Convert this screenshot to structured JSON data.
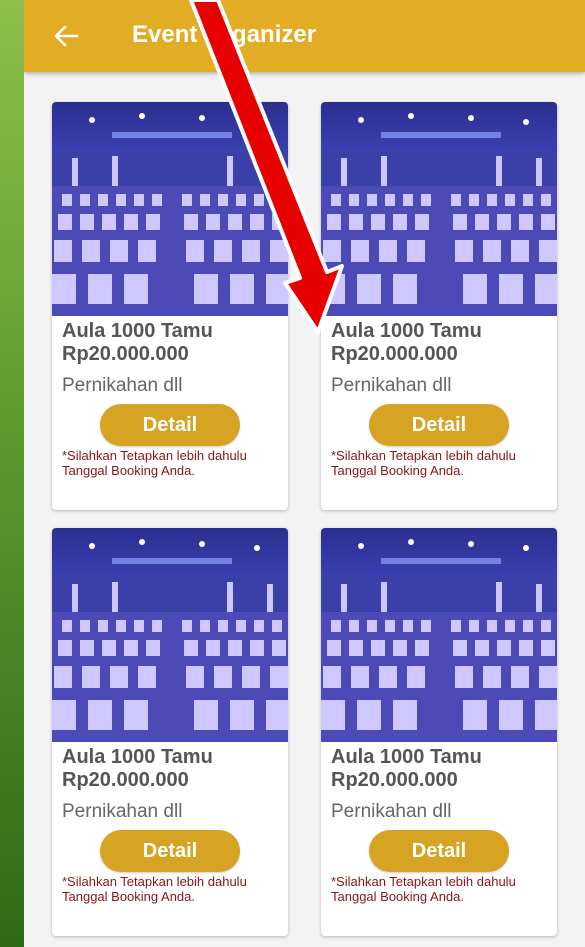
{
  "appbar": {
    "title": "Event Organizer",
    "back_icon": "arrow-left-icon",
    "color": "#e2ad25"
  },
  "cards": [
    {
      "name": "Aula 1000 Tamu",
      "price": "Rp20.000.000",
      "category": "Pernikahan dll",
      "button": "Detail",
      "note": "*Silahkan Tetapkan lebih dahulu Tanggal Booking Anda."
    },
    {
      "name": "Aula 1000 Tamu",
      "price": "Rp20.000.000",
      "category": "Pernikahan dll",
      "button": "Detail",
      "note": "*Silahkan Tetapkan lebih dahulu Tanggal Booking Anda."
    },
    {
      "name": "Aula 1000 Tamu",
      "price": "Rp20.000.000",
      "category": "Pernikahan dll",
      "button": "Detail",
      "note": "*Silahkan Tetapkan lebih dahulu Tanggal Booking Anda."
    },
    {
      "name": "Aula 1000 Tamu",
      "price": "Rp20.000.000",
      "category": "Pernikahan dll",
      "button": "Detail",
      "note": "*Silahkan Tetapkan lebih dahulu Tanggal Booking Anda."
    }
  ],
  "colors": {
    "accent": "#e2ad25",
    "button": "#d6a422",
    "note_text": "#8b1414",
    "annotation_arrow": "#e60000"
  }
}
